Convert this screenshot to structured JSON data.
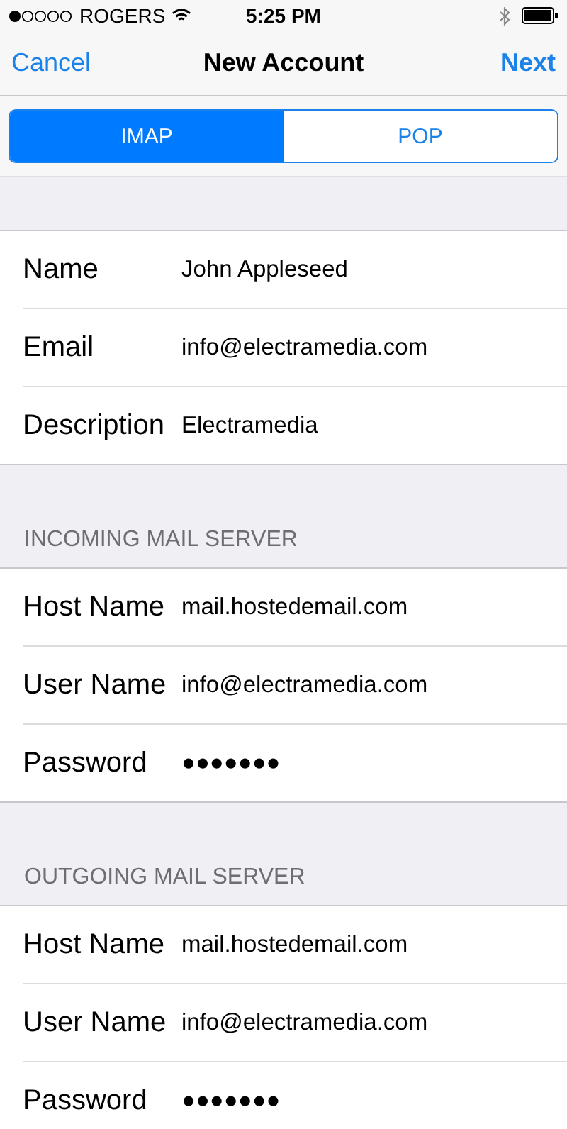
{
  "status_bar": {
    "carrier": "ROGERS",
    "time": "5:25 PM"
  },
  "nav": {
    "left": "Cancel",
    "title": "New Account",
    "right": "Next"
  },
  "tabs": [
    {
      "label": "IMAP",
      "selected": true
    },
    {
      "label": "POP",
      "selected": false
    }
  ],
  "groups": [
    {
      "fields": [
        {
          "label": "Name",
          "value": "John Appleseed"
        },
        {
          "label": "Email",
          "value": "info@electramedia.com"
        },
        {
          "label": "Description",
          "value": "Electramedia"
        }
      ]
    },
    {
      "header": "INCOMING MAIL SERVER",
      "fields": [
        {
          "label": "Host Name",
          "value": "mail.hostedemail.com"
        },
        {
          "label": "User Name",
          "value": "info@electramedia.com"
        },
        {
          "label": "Password",
          "value": "●●●●●●●"
        }
      ]
    },
    {
      "header": "OUTGOING MAIL SERVER",
      "fields": [
        {
          "label": "Host Name",
          "value": "mail.hostedemail.com"
        },
        {
          "label": "User Name",
          "value": "info@electramedia.com"
        },
        {
          "label": "Password",
          "value": "●●●●●●●"
        }
      ]
    }
  ]
}
